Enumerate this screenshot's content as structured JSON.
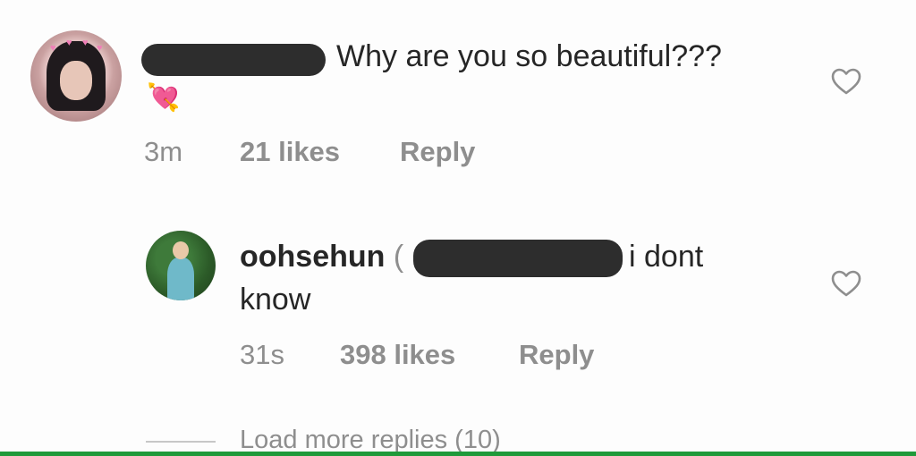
{
  "comments": [
    {
      "text": "Why are you so beautiful???",
      "emoji": "💘",
      "time": "3m",
      "likes": "21 likes",
      "reply_label": "Reply",
      "like_icon": "heart-outline-icon"
    }
  ],
  "reply": {
    "username": "oohsehun",
    "mention_prefix": "(",
    "text_line1": "i dont",
    "text_line2": "know",
    "time": "31s",
    "likes": "398 likes",
    "reply_label": "Reply",
    "like_icon": "heart-outline-icon"
  },
  "load_more": "Load more replies (10)",
  "colors": {
    "text": "#262626",
    "meta": "#8e8e8e",
    "redaction": "#2d2d2d",
    "bottom_bar": "#1f9a3a"
  }
}
